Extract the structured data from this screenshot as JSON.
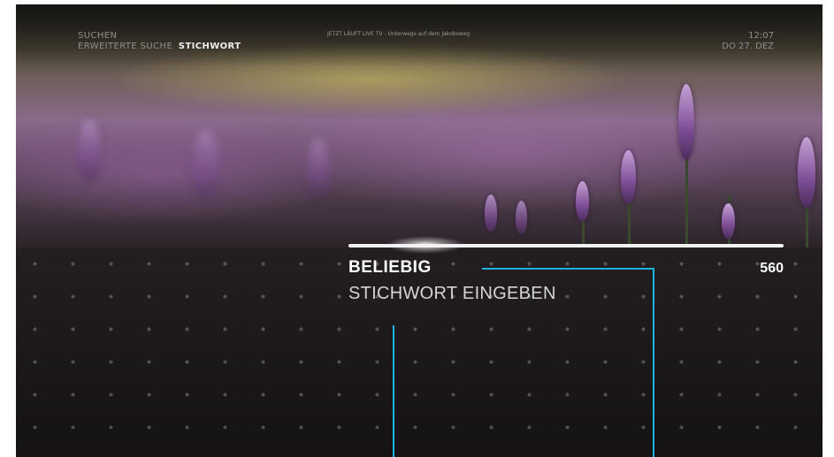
{
  "header": {
    "section_title": "SUCHEN",
    "breadcrumb_parent": "ERWEITERTE SUCHE",
    "breadcrumb_current": "STICHWORT",
    "now_playing": "JETZT LÄUFT LIVE TV - Unterwegs auf dem Jakobsweg",
    "time": "12:07",
    "date": "DO 27. DEZ"
  },
  "search_option": {
    "value": "BELIEBIG",
    "result_count": "560",
    "keyword_prompt": "STICHWORT EINGEBEN"
  },
  "colors": {
    "callout": "#1cb4dc",
    "focus_line": "#f2f2f2",
    "text_primary": "#ffffff",
    "text_secondary": "#8f8f8f"
  }
}
